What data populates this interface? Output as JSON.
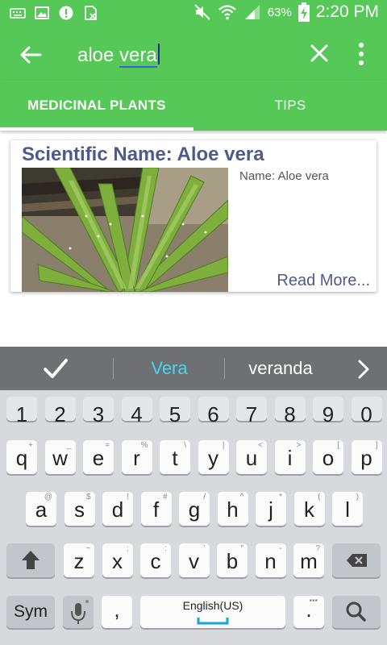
{
  "status_bar": {
    "battery_percent": "63%",
    "time": "2:20 PM",
    "icons": [
      "keyboard-icon",
      "image-icon",
      "messenger-icon",
      "sim-icon",
      "mute-icon",
      "wifi-icon",
      "signal-icon",
      "battery-charging-icon"
    ]
  },
  "search": {
    "query": "aloe vera",
    "query_underlined": "vera",
    "query_prefix": "aloe "
  },
  "tabs": [
    {
      "label": "MEDICINAL PLANTS",
      "selected": true
    },
    {
      "label": "TIPS",
      "selected": false
    }
  ],
  "result_card": {
    "title": "Scientific Name: Aloe vera",
    "name": "Name: Aloe vera",
    "read_more": "Read More...",
    "image_subject": "aloe vera plant photo"
  },
  "keyboard": {
    "suggestions": [
      "Vera",
      "veranda"
    ],
    "number_row": [
      "1",
      "2",
      "3",
      "4",
      "5",
      "6",
      "7",
      "8",
      "9",
      "0"
    ],
    "row1": [
      {
        "k": "q",
        "a": "+"
      },
      {
        "k": "w",
        "a": "_"
      },
      {
        "k": "e",
        "a": "="
      },
      {
        "k": "r",
        "a": "%"
      },
      {
        "k": "t",
        "a": "\\"
      },
      {
        "k": "y",
        "a": "|"
      },
      {
        "k": "u",
        "a": "<"
      },
      {
        "k": "i",
        "a": ">"
      },
      {
        "k": "o",
        "a": "["
      },
      {
        "k": "p",
        "a": "]"
      }
    ],
    "row2": [
      {
        "k": "a",
        "a": "@"
      },
      {
        "k": "s",
        "a": "$"
      },
      {
        "k": "d",
        "a": "!"
      },
      {
        "k": "f",
        "a": "#"
      },
      {
        "k": "g",
        "a": "/"
      },
      {
        "k": "h",
        "a": "^"
      },
      {
        "k": "j",
        "a": "*"
      },
      {
        "k": "k",
        "a": "("
      },
      {
        "k": "l",
        "a": ")"
      }
    ],
    "row3": [
      {
        "k": "z",
        "a": "~"
      },
      {
        "k": "x",
        "a": ";"
      },
      {
        "k": "c",
        "a": ":"
      },
      {
        "k": "v",
        "a": "'"
      },
      {
        "k": "b",
        "a": "\""
      },
      {
        "k": "n",
        "a": "-"
      },
      {
        "k": "m",
        "a": "?"
      }
    ],
    "sym_label": "Sym",
    "comma": ",",
    "space_label": "English(US)",
    "period": ".",
    "colors": {
      "suggestion_highlight": "#46d8f2",
      "accent_green": "#56c858"
    }
  }
}
